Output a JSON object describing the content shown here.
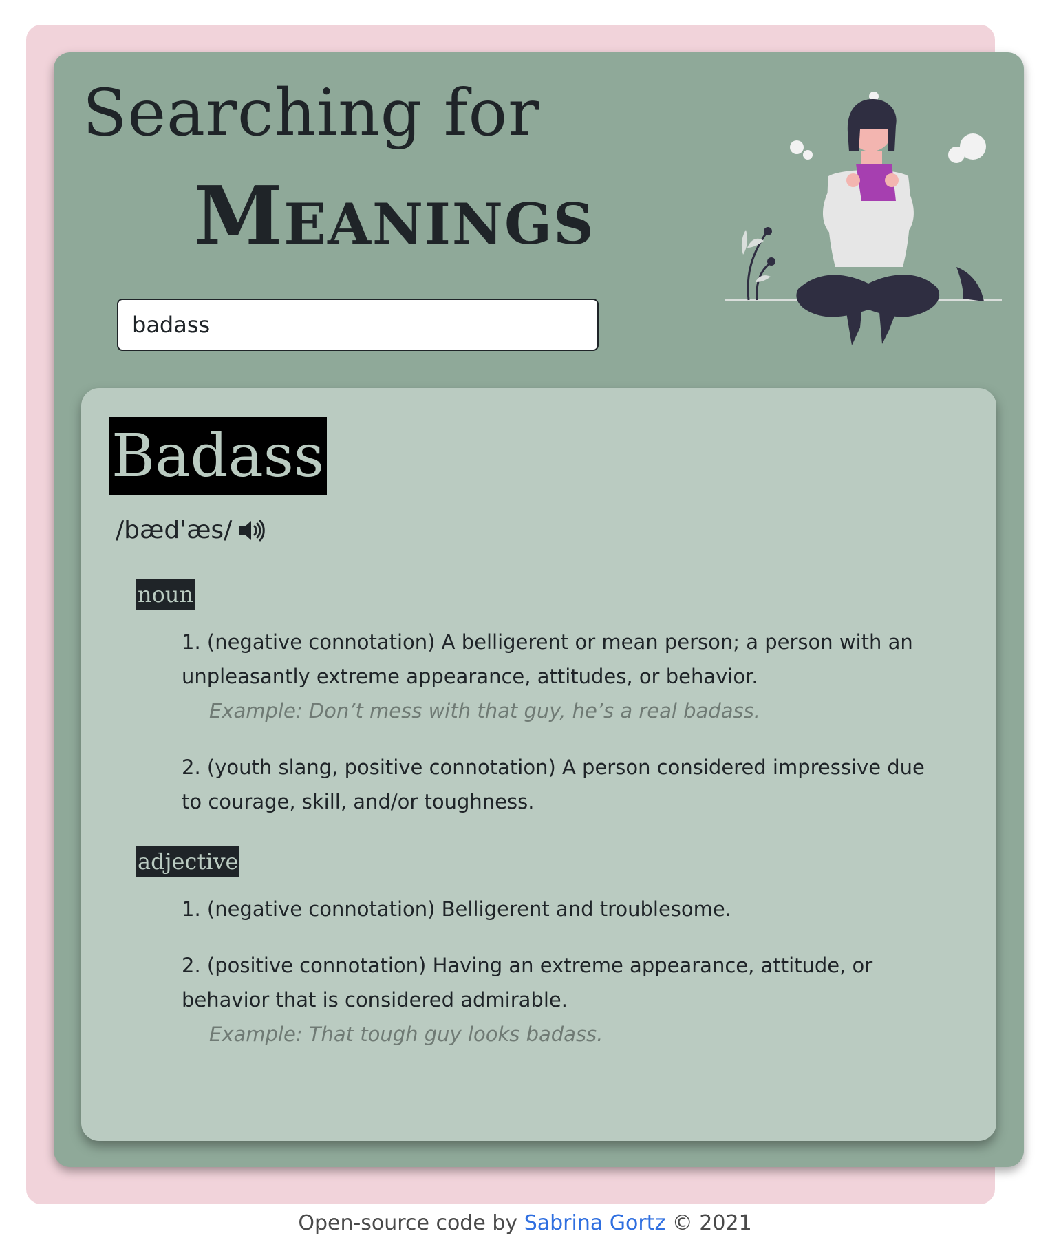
{
  "header": {
    "title_line1": "Searching for",
    "title_line2": "Meanings"
  },
  "search": {
    "value": "badass"
  },
  "illustration": {
    "icon": "woman-reading-illustration-icon",
    "colors": {
      "book": "#a63fb0",
      "hair": "#2f2e41",
      "shirt": "#e6e6e6",
      "skin": "#f3b5b0"
    }
  },
  "result": {
    "word": "Badass",
    "phonetic": "/bæd'æs/",
    "audio_icon": "speaker-icon",
    "meanings": [
      {
        "part_of_speech": "noun",
        "definitions": [
          {
            "text": "1. (negative connotation) A belligerent or mean person; a person with an unpleasantly extreme appearance, attitudes, or behavior.",
            "example": "Example: Don’t mess with that guy, he’s a real badass."
          },
          {
            "text": "2. (youth slang, positive connotation) A person considered impressive due to courage, skill, and/or toughness."
          }
        ]
      },
      {
        "part_of_speech": "adjective",
        "definitions": [
          {
            "text": "1. (negative connotation) Belligerent and troublesome."
          },
          {
            "text": "2. (positive connotation) Having an extreme appearance, attitude, or behavior that is considered admirable.",
            "example": "Example: That tough guy looks badass."
          }
        ]
      }
    ]
  },
  "footer": {
    "prefix": "Open-source code by",
    "author": "Sabrina Gortz",
    "suffix": "© 2021"
  },
  "colors": {
    "page_background": "#ffffff",
    "frame": "#f1d3da",
    "card": "#8fa999",
    "result_card": "#bacbc1",
    "text": "#1f2428",
    "example_text": "#6f7a74",
    "link": "#2f6fe0"
  }
}
